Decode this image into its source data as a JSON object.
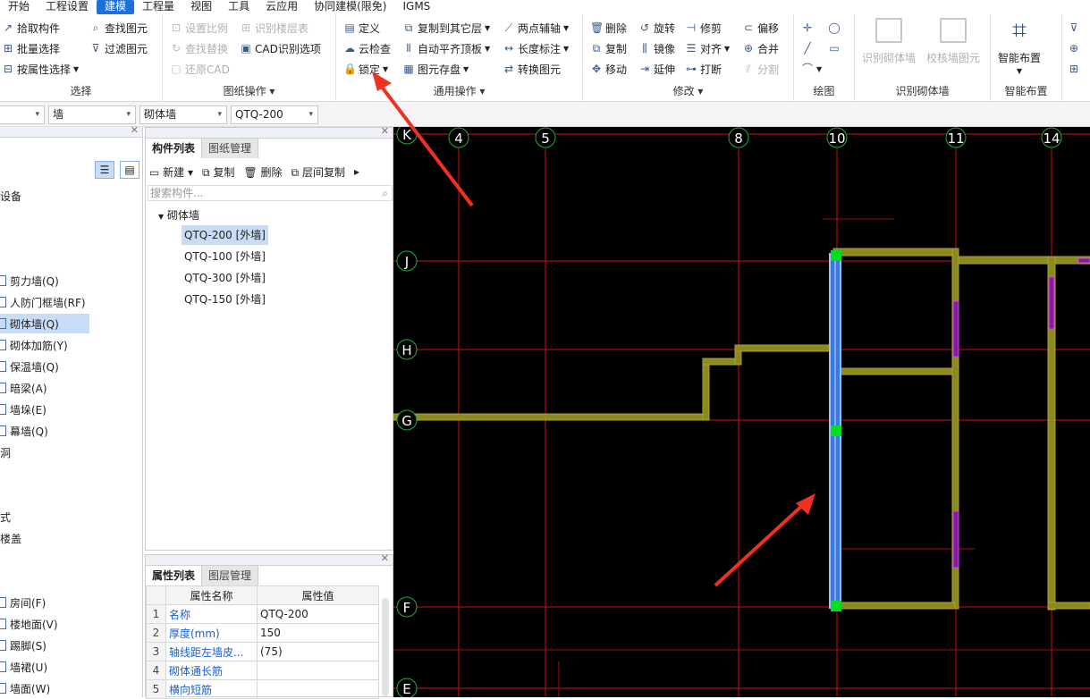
{
  "menu": [
    "开始",
    "工程设置",
    "建模",
    "工程量",
    "视图",
    "工具",
    "云应用",
    "协同建模(限免)",
    "IGMS"
  ],
  "active_menu": "建模",
  "ribbon": {
    "select_group": {
      "label": "选择",
      "items": [
        "拾取构件",
        "批量选择",
        "按属性选择",
        "查找图元",
        "过滤图元"
      ]
    },
    "drawing_group": {
      "label": "图纸操作",
      "items": [
        "设置比例",
        "查找替换",
        "还原CAD",
        "识别楼层表",
        "CAD识别选项"
      ]
    },
    "common_group": {
      "label": "通用操作",
      "items": [
        "定义",
        "云检查",
        "锁定",
        "复制到其它层",
        "自动平齐顶板",
        "图元存盘",
        "两点辅轴",
        "长度标注",
        "转换图元"
      ]
    },
    "modify_group": {
      "label": "修改",
      "items": [
        "删除",
        "旋转",
        "修剪",
        "偏移",
        "复制",
        "镜像",
        "对齐",
        "合并",
        "移动",
        "延伸",
        "打断",
        "分割"
      ]
    },
    "draw_group": {
      "label": "绘图"
    },
    "recognize_group": {
      "label": "识别砌体墙",
      "items": [
        "识别砌体墙",
        "校核墙图元"
      ]
    },
    "smart_group": {
      "label": "智能布置",
      "items": [
        "智能布置"
      ]
    }
  },
  "filters": [
    "",
    "墙",
    "砌体墙",
    "QTQ-200"
  ],
  "nav": {
    "top_fragment": "设备",
    "items": [
      "剪力墙(Q)",
      "人防门框墙(RF)",
      "砌体墙(Q)",
      "砌体加筋(Y)",
      "保温墙(Q)",
      "暗梁(A)",
      "墙垛(E)",
      "幕墙(Q)"
    ],
    "fragments": [
      "洞",
      "式",
      "楼盖"
    ],
    "items2": [
      "房间(F)",
      "楼地面(V)",
      "踢脚(S)",
      "墙裙(U)",
      "墙面(W)"
    ],
    "selected": "砌体墙(Q)"
  },
  "component_panel": {
    "tabs": [
      "构件列表",
      "图纸管理"
    ],
    "tools": [
      "新建",
      "复制",
      "删除",
      "层间复制"
    ],
    "search_placeholder": "搜索构件...",
    "root": "砌体墙",
    "items": [
      "QTQ-200 [外墙]",
      "QTQ-100 [外墙]",
      "QTQ-300 [外墙]",
      "QTQ-150 [外墙]"
    ],
    "selected": "QTQ-200 [外墙]"
  },
  "property_panel": {
    "tabs": [
      "属性列表",
      "图层管理"
    ],
    "headers": [
      "属性名称",
      "属性值"
    ],
    "rows": [
      {
        "n": "1",
        "name": "名称",
        "value": "QTQ-200"
      },
      {
        "n": "2",
        "name": "厚度(mm)",
        "value": "150"
      },
      {
        "n": "3",
        "name": "轴线距左墙皮...",
        "value": "(75)"
      },
      {
        "n": "4",
        "name": "砌体通长筋",
        "value": ""
      },
      {
        "n": "5",
        "name": "横向短筋",
        "value": ""
      }
    ]
  },
  "canvas": {
    "axis_numbers": [
      "4",
      "5",
      "8",
      "10",
      "11",
      "14"
    ],
    "axis_letters": [
      "K",
      "J",
      "H",
      "G",
      "F",
      "E"
    ],
    "colors": {
      "bg": "#000000",
      "axis": "#d01010",
      "wall": "#8a8a20",
      "selected": "#4a8aff",
      "grip": "#00e020",
      "accent": "#1e6fd9"
    }
  }
}
